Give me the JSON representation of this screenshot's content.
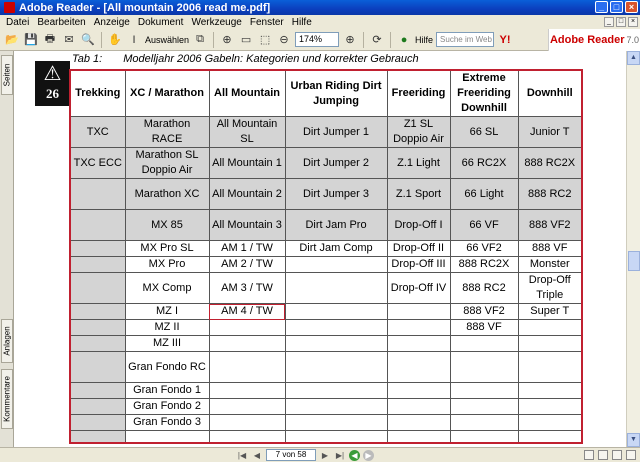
{
  "window": {
    "title": "Adobe Reader - [All mountain 2006 read me.pdf]",
    "buttons": [
      "_",
      "□",
      "×"
    ]
  },
  "menu": {
    "items": [
      "Datei",
      "Bearbeiten",
      "Anzeige",
      "Dokument",
      "Werkzeuge",
      "Fenster",
      "Hilfe"
    ]
  },
  "toolbar": {
    "select_label": "Auswählen",
    "zoom_value": "174%",
    "help_label": "Hilfe",
    "search_placeholder": "Suche im Web",
    "brand": "Adobe Reader",
    "brand_version": "7.0",
    "icons": [
      "open-icon",
      "save-icon",
      "print-icon",
      "email-icon",
      "search-icon",
      "hand-icon",
      "select-icon",
      "snapshot-icon",
      "zoom-icon",
      "actual-size-icon",
      "fit-page-icon",
      "zoom-out-icon",
      "zoom-in-icon",
      "rotate-icon",
      "help-icon",
      "yahoo-icon"
    ]
  },
  "sidebar": {
    "tabs": [
      "Seiten",
      "Anlagen",
      "Kommentare"
    ]
  },
  "document": {
    "warning_page": "26",
    "caption_label": "Tab 1:",
    "caption_text": "Modelljahr 2006 Gabeln: Kategorien und korrekter Gebrauch",
    "headers": [
      "Trekking",
      "XC / Marathon",
      "All Mountain",
      "Urban Riding Dirt Jumping",
      "Freeriding",
      "Extreme Freeriding Downhill",
      "Downhill"
    ],
    "rows": [
      [
        "TXC",
        "Marathon RACE",
        "All Mountain SL",
        "Dirt Jumper 1",
        "Z1 SL Doppio Air",
        "66 SL",
        "Junior T"
      ],
      [
        "TXC ECC",
        "Marathon SL Doppio Air",
        "All Mountain 1",
        "Dirt Jumper 2",
        "Z.1 Light",
        "66 RC2X",
        "888 RC2X"
      ],
      [
        "",
        "Marathon XC",
        "All Mountain 2",
        "Dirt Jumper 3",
        "Z.1 Sport",
        "66 Light",
        "888 RC2"
      ],
      [
        "",
        "MX 85",
        "All Mountain 3",
        "Dirt Jam Pro",
        "Drop-Off I",
        "66 VF",
        "888 VF2"
      ],
      [
        "",
        "MX Pro SL",
        "AM 1 / TW",
        "Dirt Jam Comp",
        "Drop-Off II",
        "66 VF2",
        "888 VF"
      ],
      [
        "",
        "MX Pro",
        "AM 2 / TW",
        "",
        "Drop-Off III",
        "888 RC2X",
        "Monster"
      ],
      [
        "",
        "MX Comp",
        "AM 3 / TW",
        "",
        "Drop-Off IV",
        "888 RC2",
        "Drop-Off Triple"
      ],
      [
        "",
        "MZ I",
        "AM 4 / TW",
        "",
        "",
        "888 VF2",
        "Super T"
      ],
      [
        "",
        "MZ II",
        "",
        "",
        "",
        "888 VF",
        ""
      ],
      [
        "",
        "MZ III",
        "",
        "",
        "",
        "",
        ""
      ],
      [
        "",
        "Gran Fondo RC",
        "",
        "",
        "",
        "",
        ""
      ],
      [
        "",
        "Gran Fondo 1",
        "",
        "",
        "",
        "",
        ""
      ],
      [
        "",
        "Gran Fondo 2",
        "",
        "",
        "",
        "",
        ""
      ],
      [
        "",
        "Gran Fondo 3",
        "",
        "",
        "",
        "",
        ""
      ],
      [
        "",
        "",
        "",
        "",
        "",
        "",
        ""
      ]
    ]
  },
  "statusbar": {
    "page_indicator": "7 von 58"
  }
}
